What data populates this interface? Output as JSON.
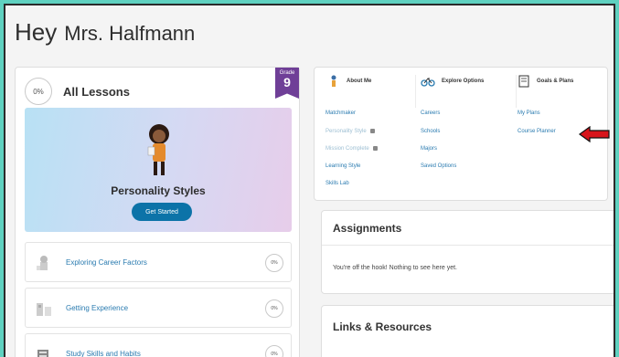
{
  "greeting": {
    "hey": "Hey",
    "name": "Mrs. Halfmann"
  },
  "lessons": {
    "percent": "0%",
    "title": "All Lessons",
    "grade_label": "Grade",
    "grade_value": "9",
    "featured": {
      "title": "Personality Styles",
      "button": "Get Started"
    },
    "items": [
      {
        "label": "Exploring Career Factors",
        "percent": "0%"
      },
      {
        "label": "Getting Experience",
        "percent": "0%"
      },
      {
        "label": "Study Skills and Habits",
        "percent": "0%"
      }
    ]
  },
  "about_me": {
    "heading": "About Me",
    "links": [
      "Matchmaker",
      "Personality Style",
      "Mission Complete",
      "Learning Style",
      "Skills Lab"
    ]
  },
  "explore": {
    "heading": "Explore Options",
    "links": [
      "Careers",
      "Schools",
      "Majors",
      "Saved Options"
    ]
  },
  "goals": {
    "heading": "Goals & Plans",
    "links": [
      "My Plans",
      "Course Planner"
    ]
  },
  "assignments": {
    "title": "Assignments",
    "message": "You're off the hook! Nothing to see here yet."
  },
  "links_resources": {
    "title": "Links & Resources"
  },
  "colors": {
    "accent": "#0c73a8",
    "grade": "#6f3f97",
    "link": "#2a7bb0",
    "arrow": "#d8141b",
    "frame_bg": "#5fd1c0"
  },
  "icons": [
    "person-icon",
    "bike-icon",
    "notebook-icon",
    "lock-icon",
    "red-arrow-icon"
  ]
}
